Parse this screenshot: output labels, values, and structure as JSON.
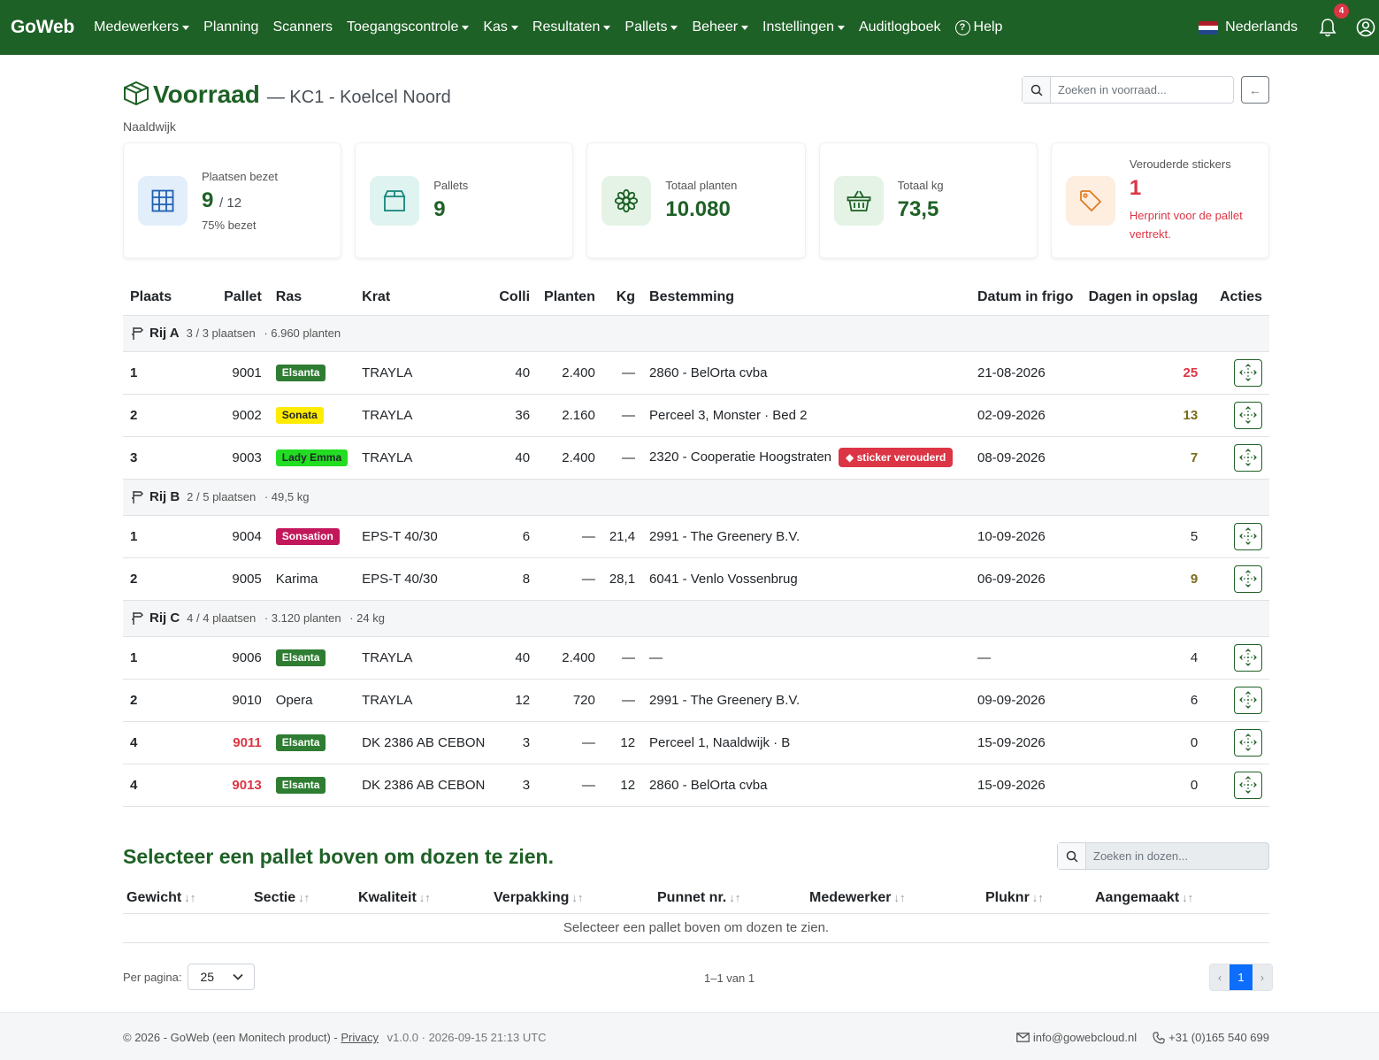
{
  "nav": {
    "brand": "GoWeb",
    "items": [
      {
        "label": "Medewerkers",
        "dropdown": true
      },
      {
        "label": "Planning",
        "dropdown": false
      },
      {
        "label": "Scanners",
        "dropdown": false
      },
      {
        "label": "Toegangscontrole",
        "dropdown": true
      },
      {
        "label": "Kas",
        "dropdown": true
      },
      {
        "label": "Resultaten",
        "dropdown": true
      },
      {
        "label": "Pallets",
        "dropdown": true
      },
      {
        "label": "Beheer",
        "dropdown": true
      },
      {
        "label": "Instellingen",
        "dropdown": true
      },
      {
        "label": "Auditlogboek",
        "dropdown": false
      }
    ],
    "help": "Help",
    "language": "Nederlands",
    "notifications": "4"
  },
  "header": {
    "title": "Voorraad",
    "subtitle": "— KC1 - Koelcel Noord",
    "location": "Naaldwijk",
    "search_placeholder": "Zoeken in voorraad..."
  },
  "stats": {
    "places": {
      "label": "Plaatsen bezet",
      "value": "9",
      "total": "/ 12",
      "note": "75% bezet"
    },
    "pallets": {
      "label": "Pallets",
      "value": "9"
    },
    "plants": {
      "label": "Totaal planten",
      "value": "10.080"
    },
    "kg": {
      "label": "Totaal kg",
      "value": "73,5"
    },
    "stickers": {
      "label": "Verouderde stickers",
      "value": "1",
      "note": "Herprint voor de pallet vertrekt."
    }
  },
  "table": {
    "headers": {
      "place": "Plaats",
      "pallet": "Pallet",
      "ras": "Ras",
      "krat": "Krat",
      "colli": "Colli",
      "planten": "Planten",
      "kg": "Kg",
      "bestemming": "Bestemming",
      "datum": "Datum in frigo",
      "dagen": "Dagen in opslag",
      "acties": "Acties"
    },
    "groups": [
      {
        "name": "Rij A",
        "places": "3 / 3 plaatsen",
        "extra1": "· 6.960 planten",
        "extra2": "",
        "rows": [
          {
            "place": "1",
            "pallet": "9001",
            "pallet_alert": false,
            "ras": "Elsanta",
            "ras_style": "green",
            "krat": "TRAYLA",
            "colli": "40",
            "planten": "2.400",
            "kg": "—",
            "bestemming": "2860 - BelOrta cvba",
            "sticker": "",
            "datum": "21-08-2026",
            "dagen": "25",
            "dagen_style": "red"
          },
          {
            "place": "2",
            "pallet": "9002",
            "pallet_alert": false,
            "ras": "Sonata",
            "ras_style": "yellow",
            "krat": "TRAYLA",
            "colli": "36",
            "planten": "2.160",
            "kg": "—",
            "bestemming": "Perceel 3, Monster · Bed 2",
            "sticker": "",
            "datum": "02-09-2026",
            "dagen": "13",
            "dagen_style": "olive"
          },
          {
            "place": "3",
            "pallet": "9003",
            "pallet_alert": false,
            "ras": "Lady Emma",
            "ras_style": "lime",
            "krat": "TRAYLA",
            "colli": "40",
            "planten": "2.400",
            "kg": "—",
            "bestemming": "2320 - Cooperatie Hoogstraten",
            "sticker": "sticker verouderd",
            "datum": "08-09-2026",
            "dagen": "7",
            "dagen_style": "olive"
          }
        ]
      },
      {
        "name": "Rij B",
        "places": "2 / 5 plaatsen",
        "extra1": "· 49,5 kg",
        "extra2": "",
        "rows": [
          {
            "place": "1",
            "pallet": "9004",
            "pallet_alert": false,
            "ras": "Sonsation",
            "ras_style": "crimson",
            "krat": "EPS-T 40/30",
            "colli": "6",
            "planten": "—",
            "kg": "21,4",
            "bestemming": "2991 - The Greenery B.V.",
            "sticker": "",
            "datum": "10-09-2026",
            "dagen": "5",
            "dagen_style": "normal"
          },
          {
            "place": "2",
            "pallet": "9005",
            "pallet_alert": false,
            "ras": "Karima",
            "ras_style": "plain",
            "krat": "EPS-T 40/30",
            "colli": "8",
            "planten": "—",
            "kg": "28,1",
            "bestemming": "6041 - Venlo Vossenbrug",
            "sticker": "",
            "datum": "06-09-2026",
            "dagen": "9",
            "dagen_style": "olive"
          }
        ]
      },
      {
        "name": "Rij C",
        "places": "4 / 4 plaatsen",
        "extra1": "· 3.120 planten",
        "extra2": "· 24 kg",
        "rows": [
          {
            "place": "1",
            "pallet": "9006",
            "pallet_alert": false,
            "ras": "Elsanta",
            "ras_style": "green",
            "krat": "TRAYLA",
            "colli": "40",
            "planten": "2.400",
            "kg": "—",
            "bestemming": "—",
            "sticker": "",
            "datum": "—",
            "dagen": "4",
            "dagen_style": "normal"
          },
          {
            "place": "2",
            "pallet": "9010",
            "pallet_alert": false,
            "ras": "Opera",
            "ras_style": "plain",
            "krat": "TRAYLA",
            "colli": "12",
            "planten": "720",
            "kg": "—",
            "bestemming": "2991 - The Greenery B.V.",
            "sticker": "",
            "datum": "09-09-2026",
            "dagen": "6",
            "dagen_style": "normal"
          },
          {
            "place": "4",
            "pallet": "9011",
            "pallet_alert": true,
            "ras": "Elsanta",
            "ras_style": "green",
            "krat": "DK 2386 AB CEBON",
            "colli": "3",
            "planten": "—",
            "kg": "12",
            "bestemming": "Perceel 1, Naaldwijk · B",
            "sticker": "",
            "datum": "15-09-2026",
            "dagen": "0",
            "dagen_style": "normal"
          },
          {
            "place": "4",
            "pallet": "9013",
            "pallet_alert": true,
            "ras": "Elsanta",
            "ras_style": "green",
            "krat": "DK 2386 AB CEBON",
            "colli": "3",
            "planten": "—",
            "kg": "12",
            "bestemming": "2860 - BelOrta cvba",
            "sticker": "",
            "datum": "15-09-2026",
            "dagen": "0",
            "dagen_style": "normal"
          }
        ]
      }
    ]
  },
  "boxes": {
    "title": "Selecteer een pallet boven om dozen te zien.",
    "search_placeholder": "Zoeken in dozen...",
    "headers": [
      "Gewicht",
      "Sectie",
      "Kwaliteit",
      "Verpakking",
      "Punnet nr.",
      "Medewerker",
      "Pluknr",
      "Aangemaakt"
    ],
    "empty": "Selecteer een pallet boven om dozen te zien.",
    "per_page_label": "Per pagina:",
    "per_page": "25",
    "range": "1–1 van 1",
    "page": "1",
    "prev": "‹",
    "next": "›"
  },
  "footer": {
    "copyright": "© 2026 - GoWeb (een Monitech product) -",
    "privacy": "Privacy",
    "version": "v1.0.0 · 2026-09-15 21:13 UTC",
    "email": "info@gowebcloud.nl",
    "phone": "+31 (0)165 540 699"
  },
  "colors": {
    "brand_green": "#1e6126",
    "danger": "#dc3545",
    "tag_green": "#2e7d32",
    "tag_yellow": "#ffeb00",
    "tag_lime": "#22dd22",
    "tag_crimson": "#c2185b",
    "primary": "#0d6efd"
  }
}
